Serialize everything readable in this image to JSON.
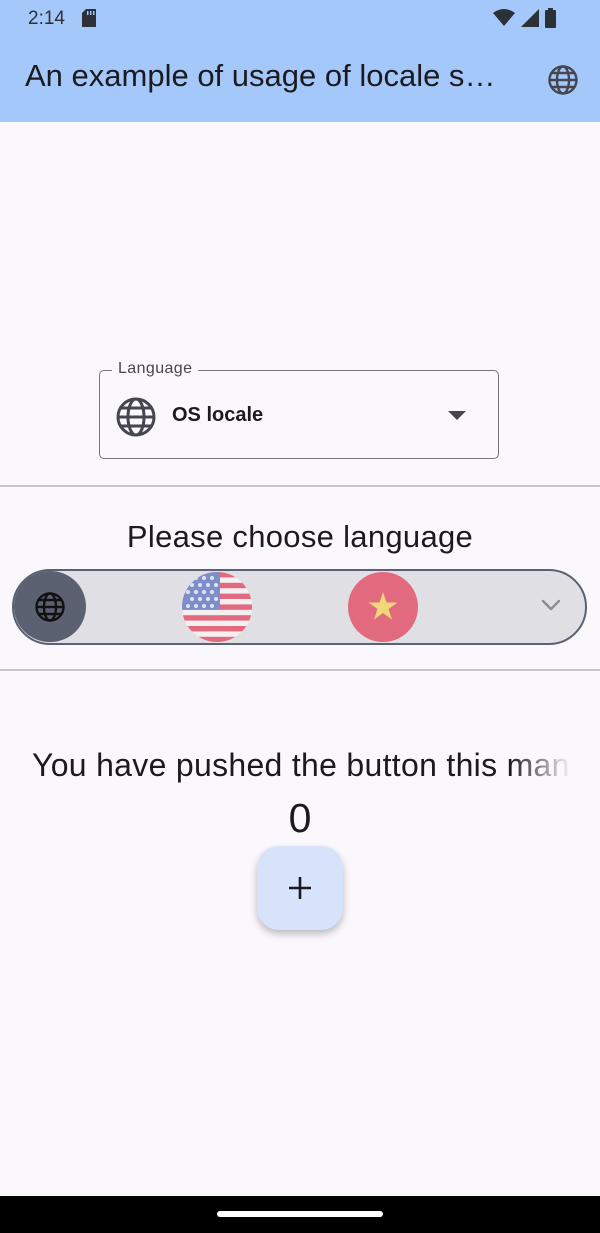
{
  "status_bar": {
    "time": "2:14"
  },
  "app_bar": {
    "title": "An example of usage of locale switcher"
  },
  "language_dropdown": {
    "label": "Language",
    "value": "OS locale"
  },
  "selector": {
    "heading": "Please choose language",
    "options": [
      "system-locale",
      "en-US",
      "vi"
    ]
  },
  "counter": {
    "label": "You have pushed the button this many times:",
    "value": "0",
    "fab_label": "+"
  },
  "colors": {
    "app_bar": "#a5c8fb",
    "background": "#fbf8fd",
    "fab": "#d6e3fb",
    "selector_track": "#e0dfe4"
  }
}
